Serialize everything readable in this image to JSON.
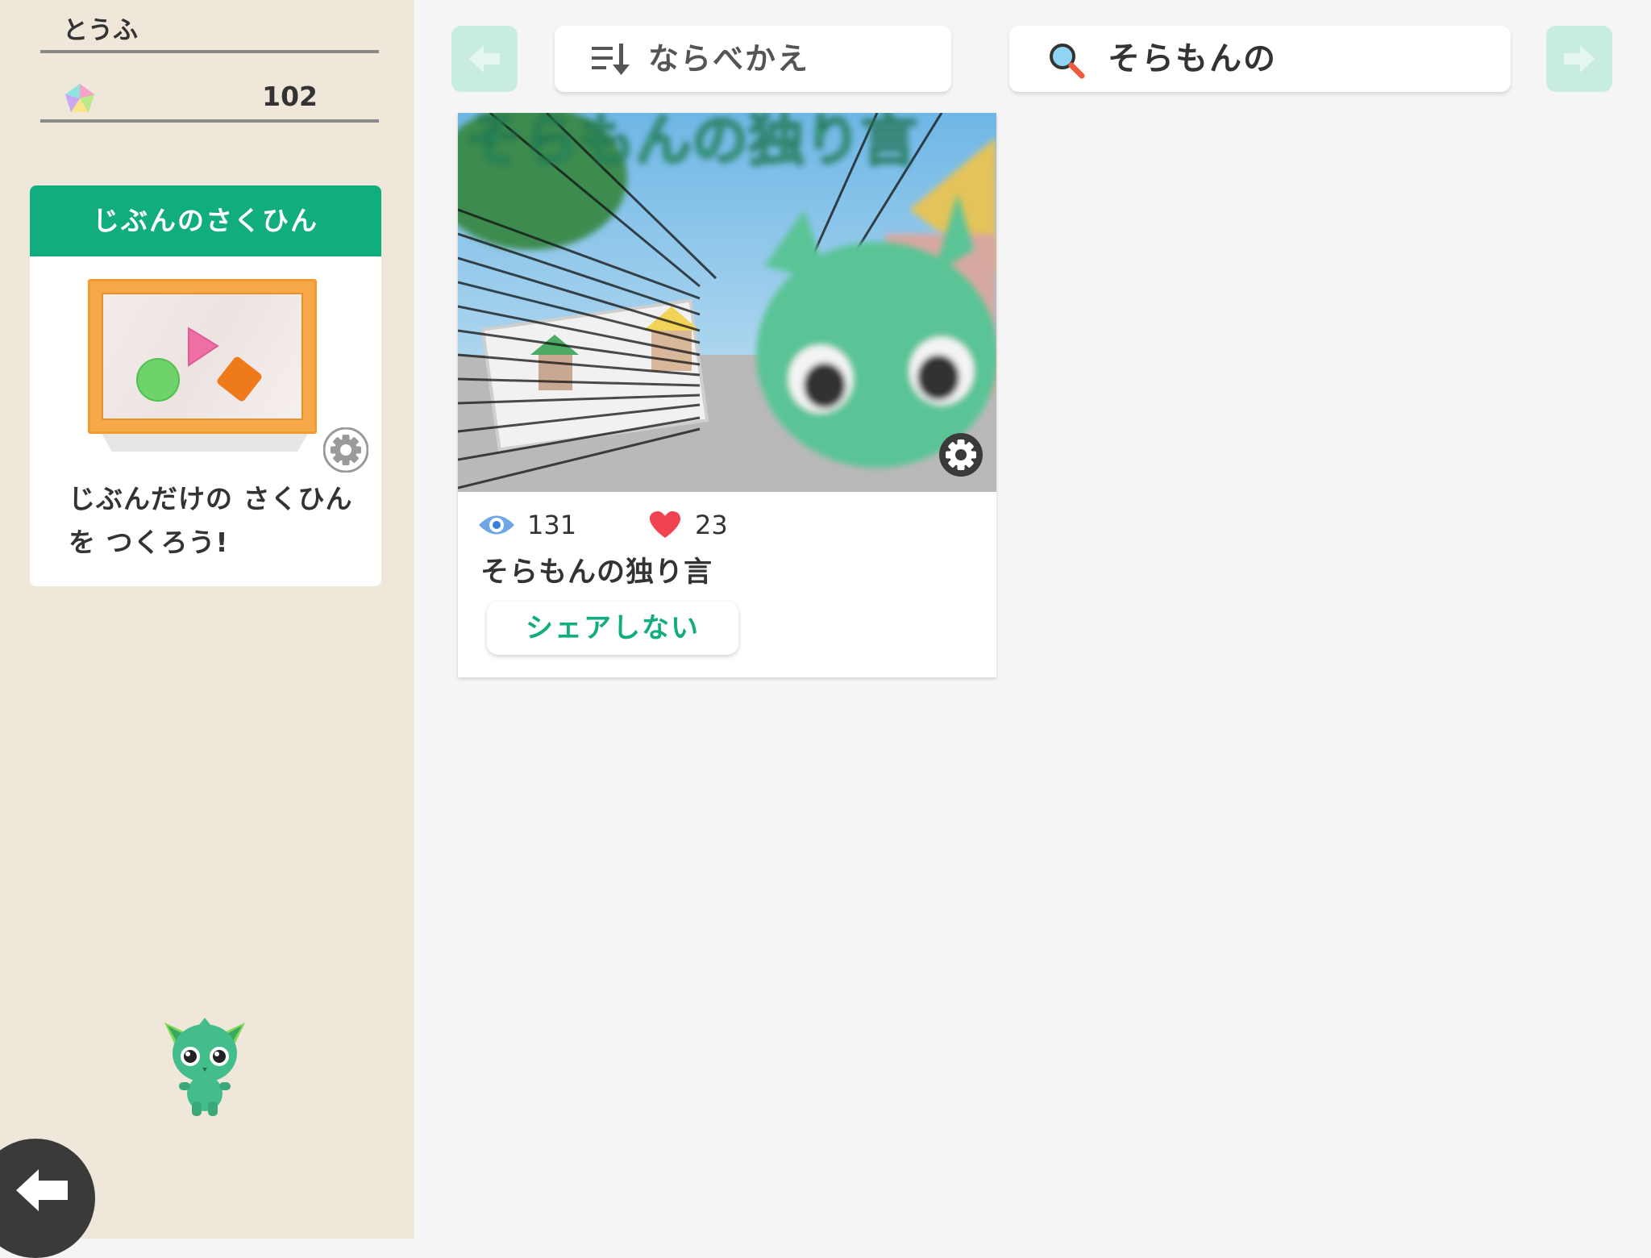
{
  "user": {
    "name": "とうふ",
    "points": "102",
    "gem_icon": "rainbow-gem-icon"
  },
  "my_works": {
    "header": "じぶんのさくひん",
    "description": "じぶんだけの さくひんを つくろう!"
  },
  "toolbar": {
    "sort_label": "ならべかえ",
    "search_value": "そらもんの"
  },
  "works": [
    {
      "title": "そらもんの独り言",
      "views": "131",
      "likes": "23",
      "share_label": "シェアしない"
    }
  ],
  "colors": {
    "accent": "#11ad7e",
    "sidebar_bg": "#efe7da",
    "nav_disabled": "#c8ece0"
  }
}
